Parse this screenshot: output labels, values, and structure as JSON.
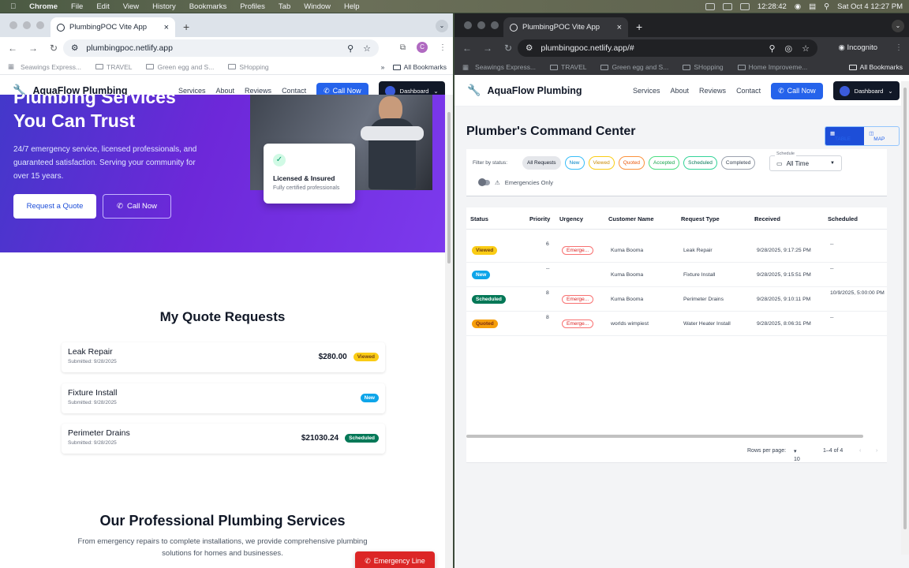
{
  "menubar": {
    "app": "Chrome",
    "items": [
      "File",
      "Edit",
      "View",
      "History",
      "Bookmarks",
      "Profiles",
      "Tab",
      "Window",
      "Help"
    ],
    "timer": "12:28:42",
    "datetime": "Sat Oct 4  12:27 PM"
  },
  "left_browser": {
    "tab_title": "PlumbingPOC Vite App",
    "url": "plumbingpoc.netlify.app",
    "profile_initial": "C",
    "bookmarks": [
      "Seawings Express...",
      "TRAVEL",
      "Green egg and S...",
      "SHopping"
    ],
    "all_bookmarks": "All Bookmarks"
  },
  "right_browser": {
    "tab_title": "PlumbingPOC Vite App",
    "url": "plumbingpoc.netlify.app/#",
    "incognito": "Incognito",
    "bookmarks": [
      "Seawings Express...",
      "TRAVEL",
      "Green egg and S...",
      "SHopping",
      "Home Improveme..."
    ],
    "all_bookmarks": "All Bookmarks"
  },
  "site": {
    "logo": "AquaFlow Plumbing",
    "nav": [
      "Services",
      "About",
      "Reviews",
      "Contact"
    ],
    "call_now": "Call Now",
    "dashboard": "Dashboard"
  },
  "hero": {
    "title_line1": "Plumbing Services",
    "title_line2": "You Can Trust",
    "description": "24/7 emergency service, licensed professionals, and guaranteed satisfaction. Serving your community for over 15 years.",
    "request_quote": "Request a Quote",
    "call_now": "Call Now",
    "badge_title": "Licensed & Insured",
    "badge_sub": "Fully certified professionals"
  },
  "quotes": {
    "title": "My Quote Requests",
    "items": [
      {
        "name": "Leak Repair",
        "submitted": "Submitted: 9/28/2025",
        "amount": "$280.00",
        "status": "Viewed"
      },
      {
        "name": "Fixture Install",
        "submitted": "Submitted: 9/28/2025",
        "amount": "",
        "status": "New"
      },
      {
        "name": "Perimeter Drains",
        "submitted": "Submitted: 9/28/2025",
        "amount": "$21030.24",
        "status": "Scheduled"
      }
    ]
  },
  "services": {
    "title": "Our Professional Plumbing Services",
    "subtitle": "From emergency repairs to complete installations, we provide comprehensive plumbing solutions for homes and businesses.",
    "emergency": "Emergency Line"
  },
  "command_center": {
    "title": "Plumber's Command Center",
    "view_table": "TABLE",
    "view_map": "MAP",
    "filter_label": "Filter by status:",
    "chips": [
      "All Requests",
      "New",
      "Viewed",
      "Quoted",
      "Accepted",
      "Scheduled",
      "Completed"
    ],
    "schedule_caption": "Schedule",
    "schedule_value": "All Time",
    "emergencies_only": "Emergencies Only",
    "columns": [
      "Status",
      "Priority",
      "Urgency",
      "Customer Name",
      "Request Type",
      "Received",
      "Scheduled"
    ],
    "rows": [
      {
        "status": "Viewed",
        "priority": "6",
        "urgency": "Emerge...",
        "customer": "Kuma Booma",
        "type": "Leak Repair",
        "received": "9/28/2025, 9:17:25 PM",
        "scheduled": "--"
      },
      {
        "status": "New",
        "priority": "--",
        "urgency": "",
        "customer": "Kuma Booma",
        "type": "Fixture Install",
        "received": "9/28/2025, 9:15:51 PM",
        "scheduled": "--"
      },
      {
        "status": "Scheduled",
        "priority": "8",
        "urgency": "Emerge...",
        "customer": "Kuma Booma",
        "type": "Perimeter Drains",
        "received": "9/28/2025, 9:10:11 PM",
        "scheduled": "10/9/2025, 5:00:00 PM"
      },
      {
        "status": "Quoted",
        "priority": "8",
        "urgency": "Emerge...",
        "customer": "worlds wimpiest",
        "type": "Water Heater Install",
        "received": "9/28/2025, 8:06:31 PM",
        "scheduled": "--"
      }
    ],
    "rows_per_page_label": "Rows per page:",
    "rows_per_page": "10",
    "range": "1–4 of 4"
  }
}
